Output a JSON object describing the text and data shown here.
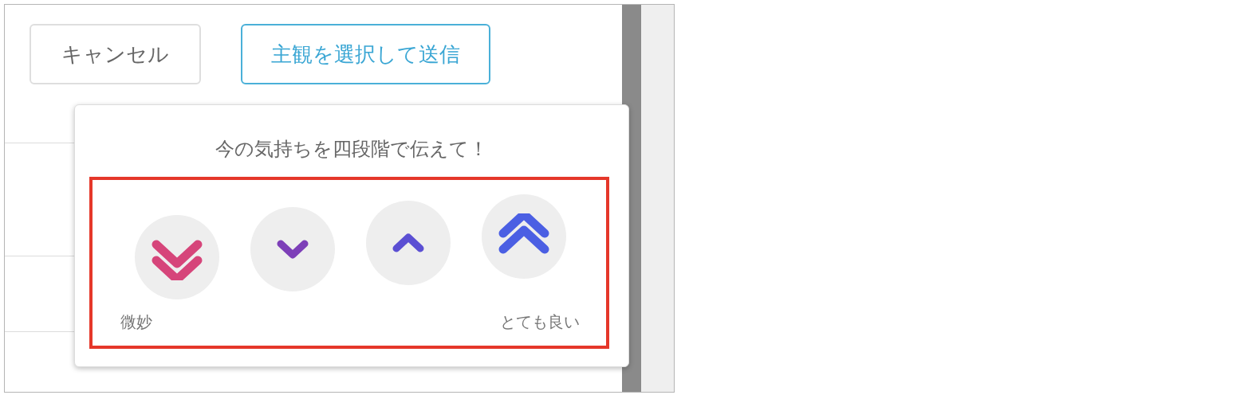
{
  "buttons": [
    {
      "label": "キャンセル",
      "kind": "cancel"
    },
    {
      "label": "主観を選択して送信",
      "kind": "submit"
    }
  ],
  "popup": {
    "title": "今の気持ちを四段階で伝えて！",
    "options": [
      {
        "kind": "double-down",
        "color": "#d6457a"
      },
      {
        "kind": "down",
        "color": "#7d3fb8"
      },
      {
        "kind": "up",
        "color": "#5b4fd3"
      },
      {
        "kind": "double-up",
        "color": "#4b5fe3"
      }
    ],
    "low_label": "微妙",
    "high_label": "とても良い"
  }
}
